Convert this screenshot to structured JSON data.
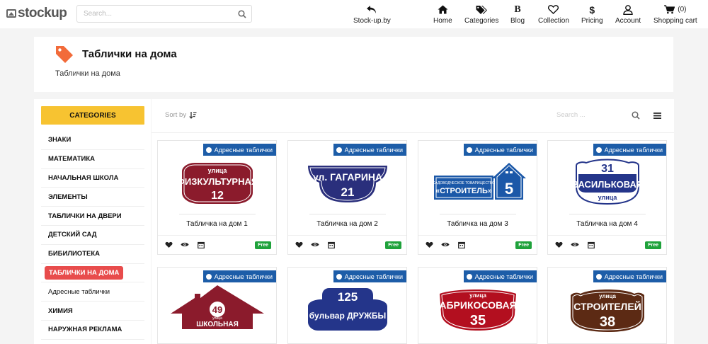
{
  "brand": {
    "name": "stockup"
  },
  "search": {
    "placeholder": "Search..."
  },
  "nav": {
    "back_label": "Stock-up.by",
    "home_label": "Home",
    "categories_label": "Categories",
    "blog_label": "Blog",
    "collection_label": "Collection",
    "pricing_label": "Pricing",
    "account_label": "Account",
    "cart_label": "Shopping cart",
    "cart_count": "(0)"
  },
  "header": {
    "title": "Таблички на дома",
    "breadcrumb": "Таблички на дома"
  },
  "sidebar": {
    "heading": "CATEGORIES",
    "items": [
      {
        "label": "ЗНАКИ"
      },
      {
        "label": "МАТЕМАТИКА"
      },
      {
        "label": "НАЧАЛЬНАЯ ШКОЛА"
      },
      {
        "label": "ЭЛЕМЕНТЫ"
      },
      {
        "label": "ТАБЛИЧКИ НА ДВЕРИ"
      },
      {
        "label": "ДЕТСКИЙ САД"
      },
      {
        "label": "БИБИЛИОТЕКА"
      },
      {
        "label": "ТАБЛИЧКИ НА ДОМА"
      },
      {
        "label": "Адресные таблички"
      },
      {
        "label": "ХИМИЯ"
      },
      {
        "label": "НАРУЖНАЯ РЕКЛАМА"
      }
    ]
  },
  "toolbar": {
    "sort_label": "Sort by",
    "search_placeholder": "Search ..."
  },
  "colors": {
    "accent_yellow": "#f7c331",
    "active_red": "#e84c4c",
    "badge_blue": "#1d5da8",
    "free_green": "#1fa23b",
    "brand_orange": "#f26b3a"
  },
  "cards": [
    {
      "badge": "Адресные таблички",
      "title": "Табличка на дом 1",
      "price": "Free",
      "sign": {
        "line1": "улица",
        "line2": "ФИЗКУЛЬТУРНАЯ",
        "number": "12"
      }
    },
    {
      "badge": "Адресные таблички",
      "title": "Табличка на дом 2",
      "price": "Free",
      "sign": {
        "line1": "ул. ГАГАРИНА",
        "number": "21"
      }
    },
    {
      "badge": "Адресные таблички",
      "title": "Табличка на дом 3",
      "price": "Free",
      "sign": {
        "line1": "САДОВОДЧЕСКОЕ ТОВАРИЩЕСТВО",
        "line2": "«СТРОИТЕЛЬ»",
        "number": "5"
      }
    },
    {
      "badge": "Адресные таблички",
      "title": "Табличка на дом 4",
      "price": "Free",
      "sign": {
        "number": "31",
        "line1": "ВАСИЛЬКОВАЯ",
        "line2": "улица"
      }
    },
    {
      "badge": "Адресные таблички",
      "sign": {
        "number": "49",
        "line1": "улица",
        "line2": "ШКОЛЬНАЯ"
      }
    },
    {
      "badge": "Адресные таблички",
      "sign": {
        "number": "125",
        "line1": "бульвар  ДРУЖБЫ"
      }
    },
    {
      "badge": "Адресные таблички",
      "sign": {
        "line1": "улица",
        "line2": "АБРИКОСОВАЯ",
        "number": "35"
      }
    },
    {
      "badge": "Адресные таблички",
      "sign": {
        "line1": "улица",
        "line2": "СТРОИТЕЛЕЙ",
        "number": "38"
      }
    }
  ]
}
